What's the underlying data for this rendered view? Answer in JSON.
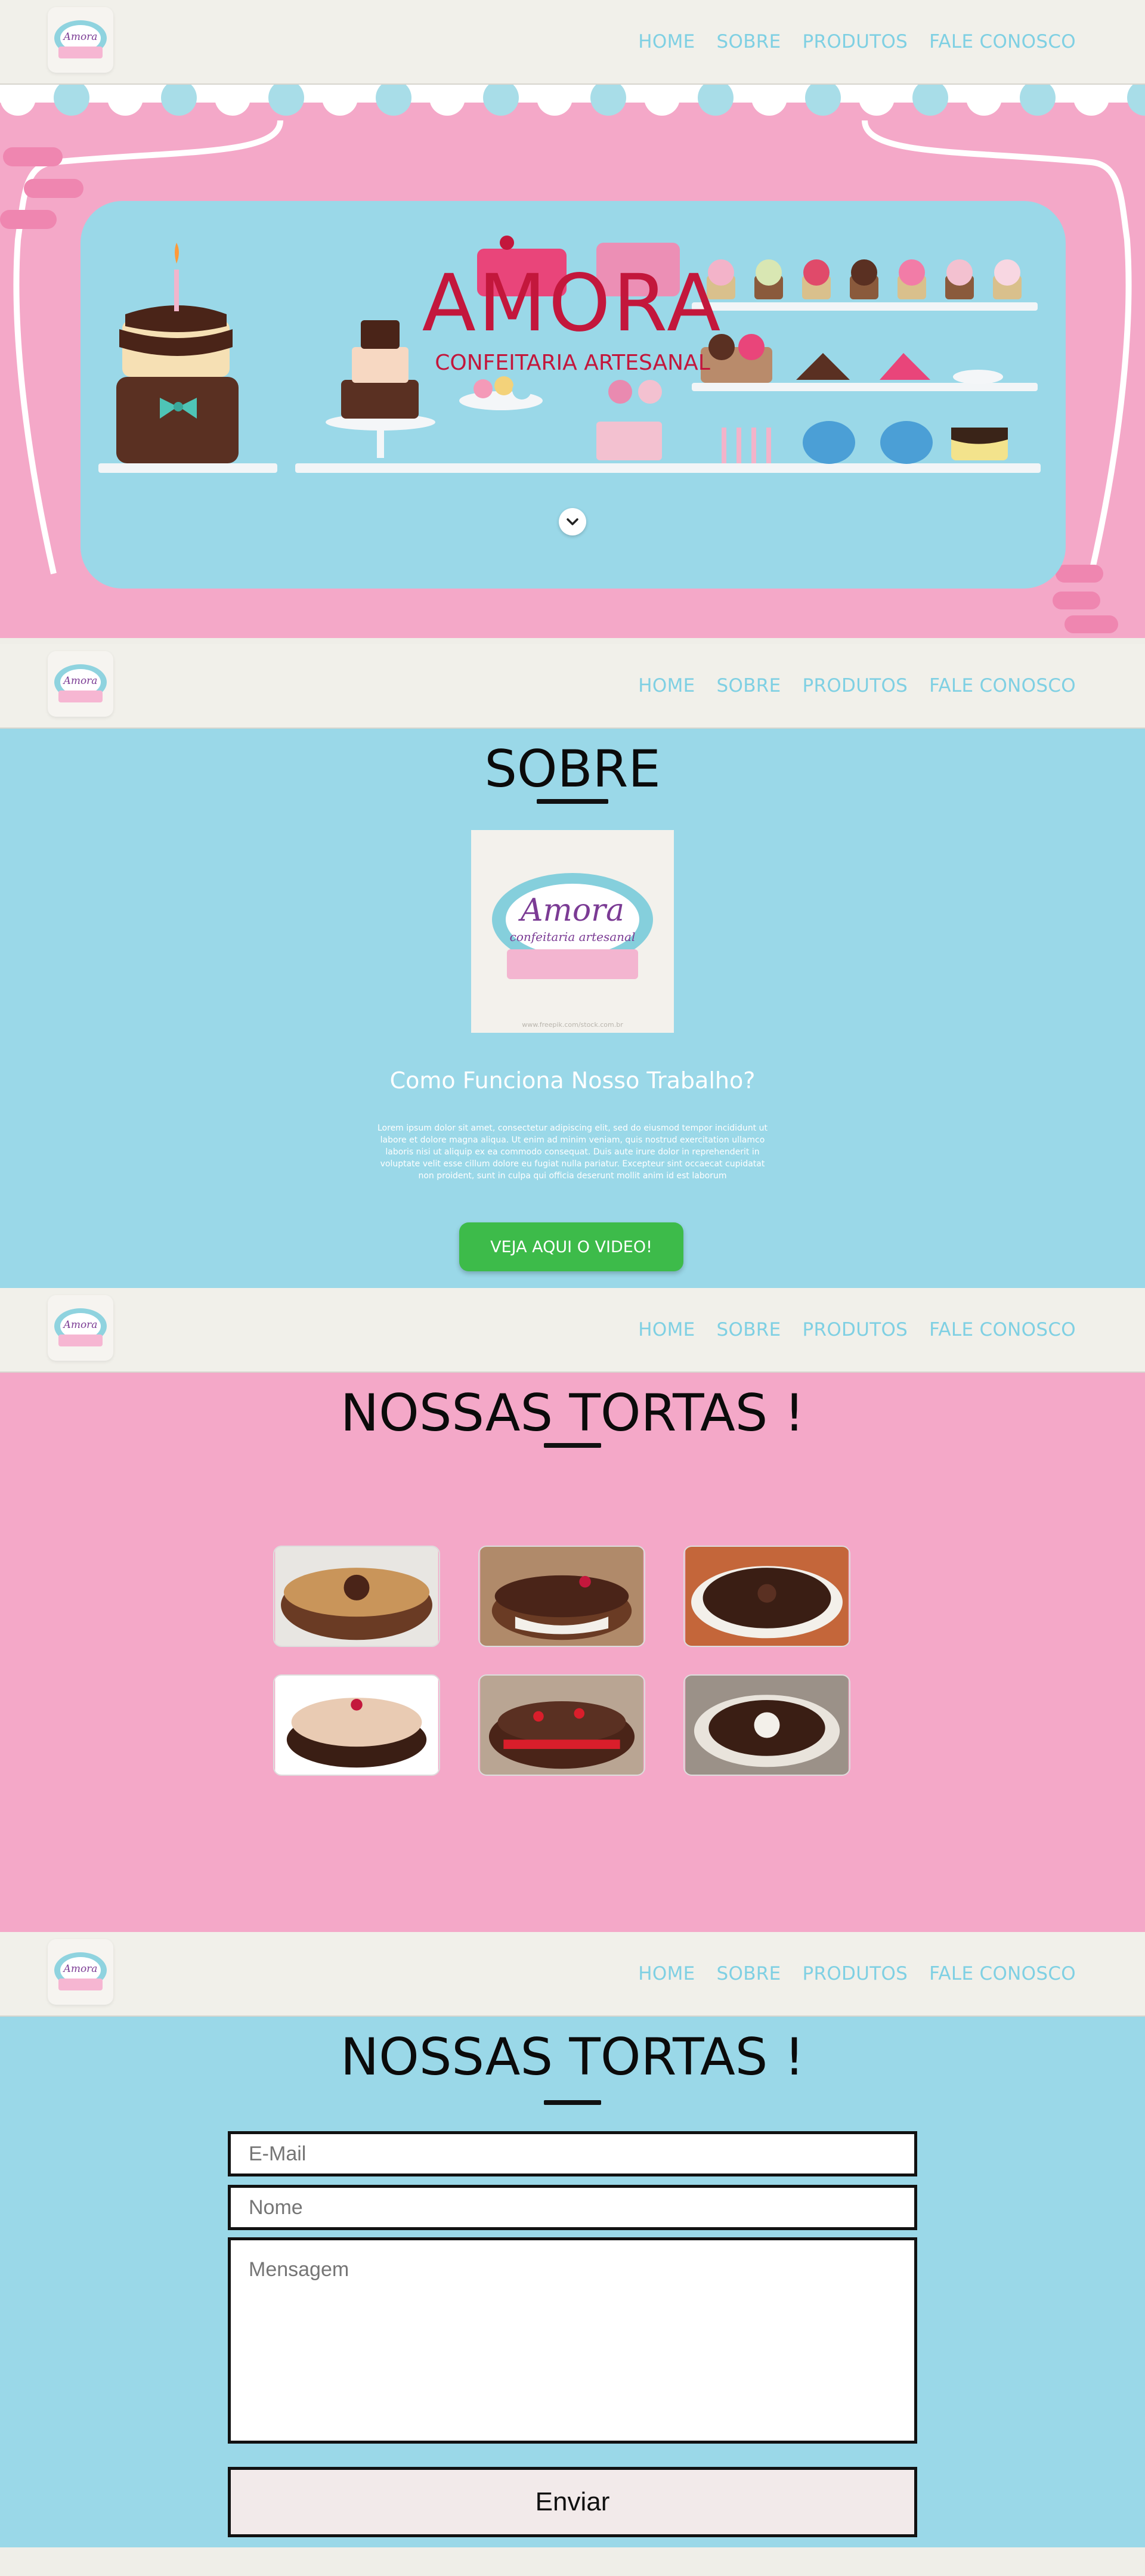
{
  "nav": {
    "home": "HOME",
    "sobre": "SOBRE",
    "produtos": "PRODUTOS",
    "contato": "FALE CONOSCO"
  },
  "logo": {
    "brand": "Amora",
    "tagline": "confeitaria artesanal"
  },
  "hero": {
    "title": "AMORA",
    "subtitle": "CONFEITARIA ARTESANAL",
    "scroll_icon": "chevron-down-icon"
  },
  "sobre": {
    "title": "SOBRE",
    "logo_brand": "Amora",
    "logo_tagline": "confeitaria artesanal",
    "logo_watermark": "www.freepik.com/stock.com.br",
    "subtitle": "Como Funciona Nosso Trabalho?",
    "text": "Lorem ipsum dolor sit amet, consectetur adipiscing elit, sed do eiusmod tempor incididunt ut labore et dolore magna aliqua. Ut enim ad minim veniam, quis nostrud exercitation ullamco laboris nisi ut aliquip ex ea commodo consequat. Duis aute irure dolor in reprehenderit in voluptate velit esse cillum dolore eu fugiat nulla pariatur. Excepteur sint occaecat cupidatat non proident, sunt in culpa qui officia deserunt mollit anim id est laborum",
    "button": "VEJA AQUI O VIDEO!"
  },
  "tortas": {
    "title": "NOSSAS TORTAS !"
  },
  "contato": {
    "title": "NOSSAS TORTAS !",
    "email_placeholder": "E-Mail",
    "nome_placeholder": "Nome",
    "mensagem_placeholder": "Mensagem",
    "button": "Enviar"
  },
  "colors": {
    "pink": "#f5a7c8",
    "blue": "#9ad8e8",
    "green": "#3dbb4a",
    "brand_red": "#c3173c",
    "nav_link": "#7fd0e3"
  }
}
